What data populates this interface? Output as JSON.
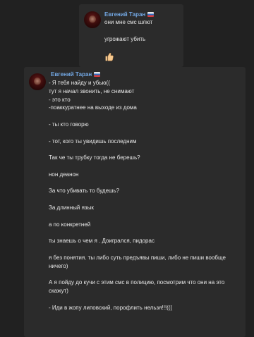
{
  "message1": {
    "author": "Евгений Таран",
    "lines": [
      "они мне смс шлют",
      "",
      "угрожают убить"
    ],
    "emoji": "thumbs-up-icon"
  },
  "message2": {
    "author": "Евгений Таран",
    "lines": [
      "- Я тебя найду и убью((",
      "тут я начал звонить, не снимают",
      "- это кто",
      "-поаккуратнее на выходе из дома",
      "",
      "- ты кто говорю",
      "",
      "- тот, кого ты увидишь последним",
      "",
      "Так че ты трубку тогда не берешь?",
      "",
      "нон деанон",
      "",
      "За что убивать то будешь?",
      "",
      "За длинный язык",
      "",
      "а по конкретней",
      "",
      "ты знаешь о чем я . Доигрался, пидорас",
      "",
      "я без понятия. ты либо суть предъявы пиши, либо не пиши вообще ничего)",
      "",
      "А я пойду до кучи с этим смс в полицию, посмотрим что они на это скажут)",
      "",
      "- Иди в жопу липовский, порофлить нельзя!!!((("
    ]
  },
  "colors": {
    "background": "#212121",
    "bubble": "#2b2b2b",
    "author": "#73a8e4",
    "text": "#e8e8e8"
  }
}
